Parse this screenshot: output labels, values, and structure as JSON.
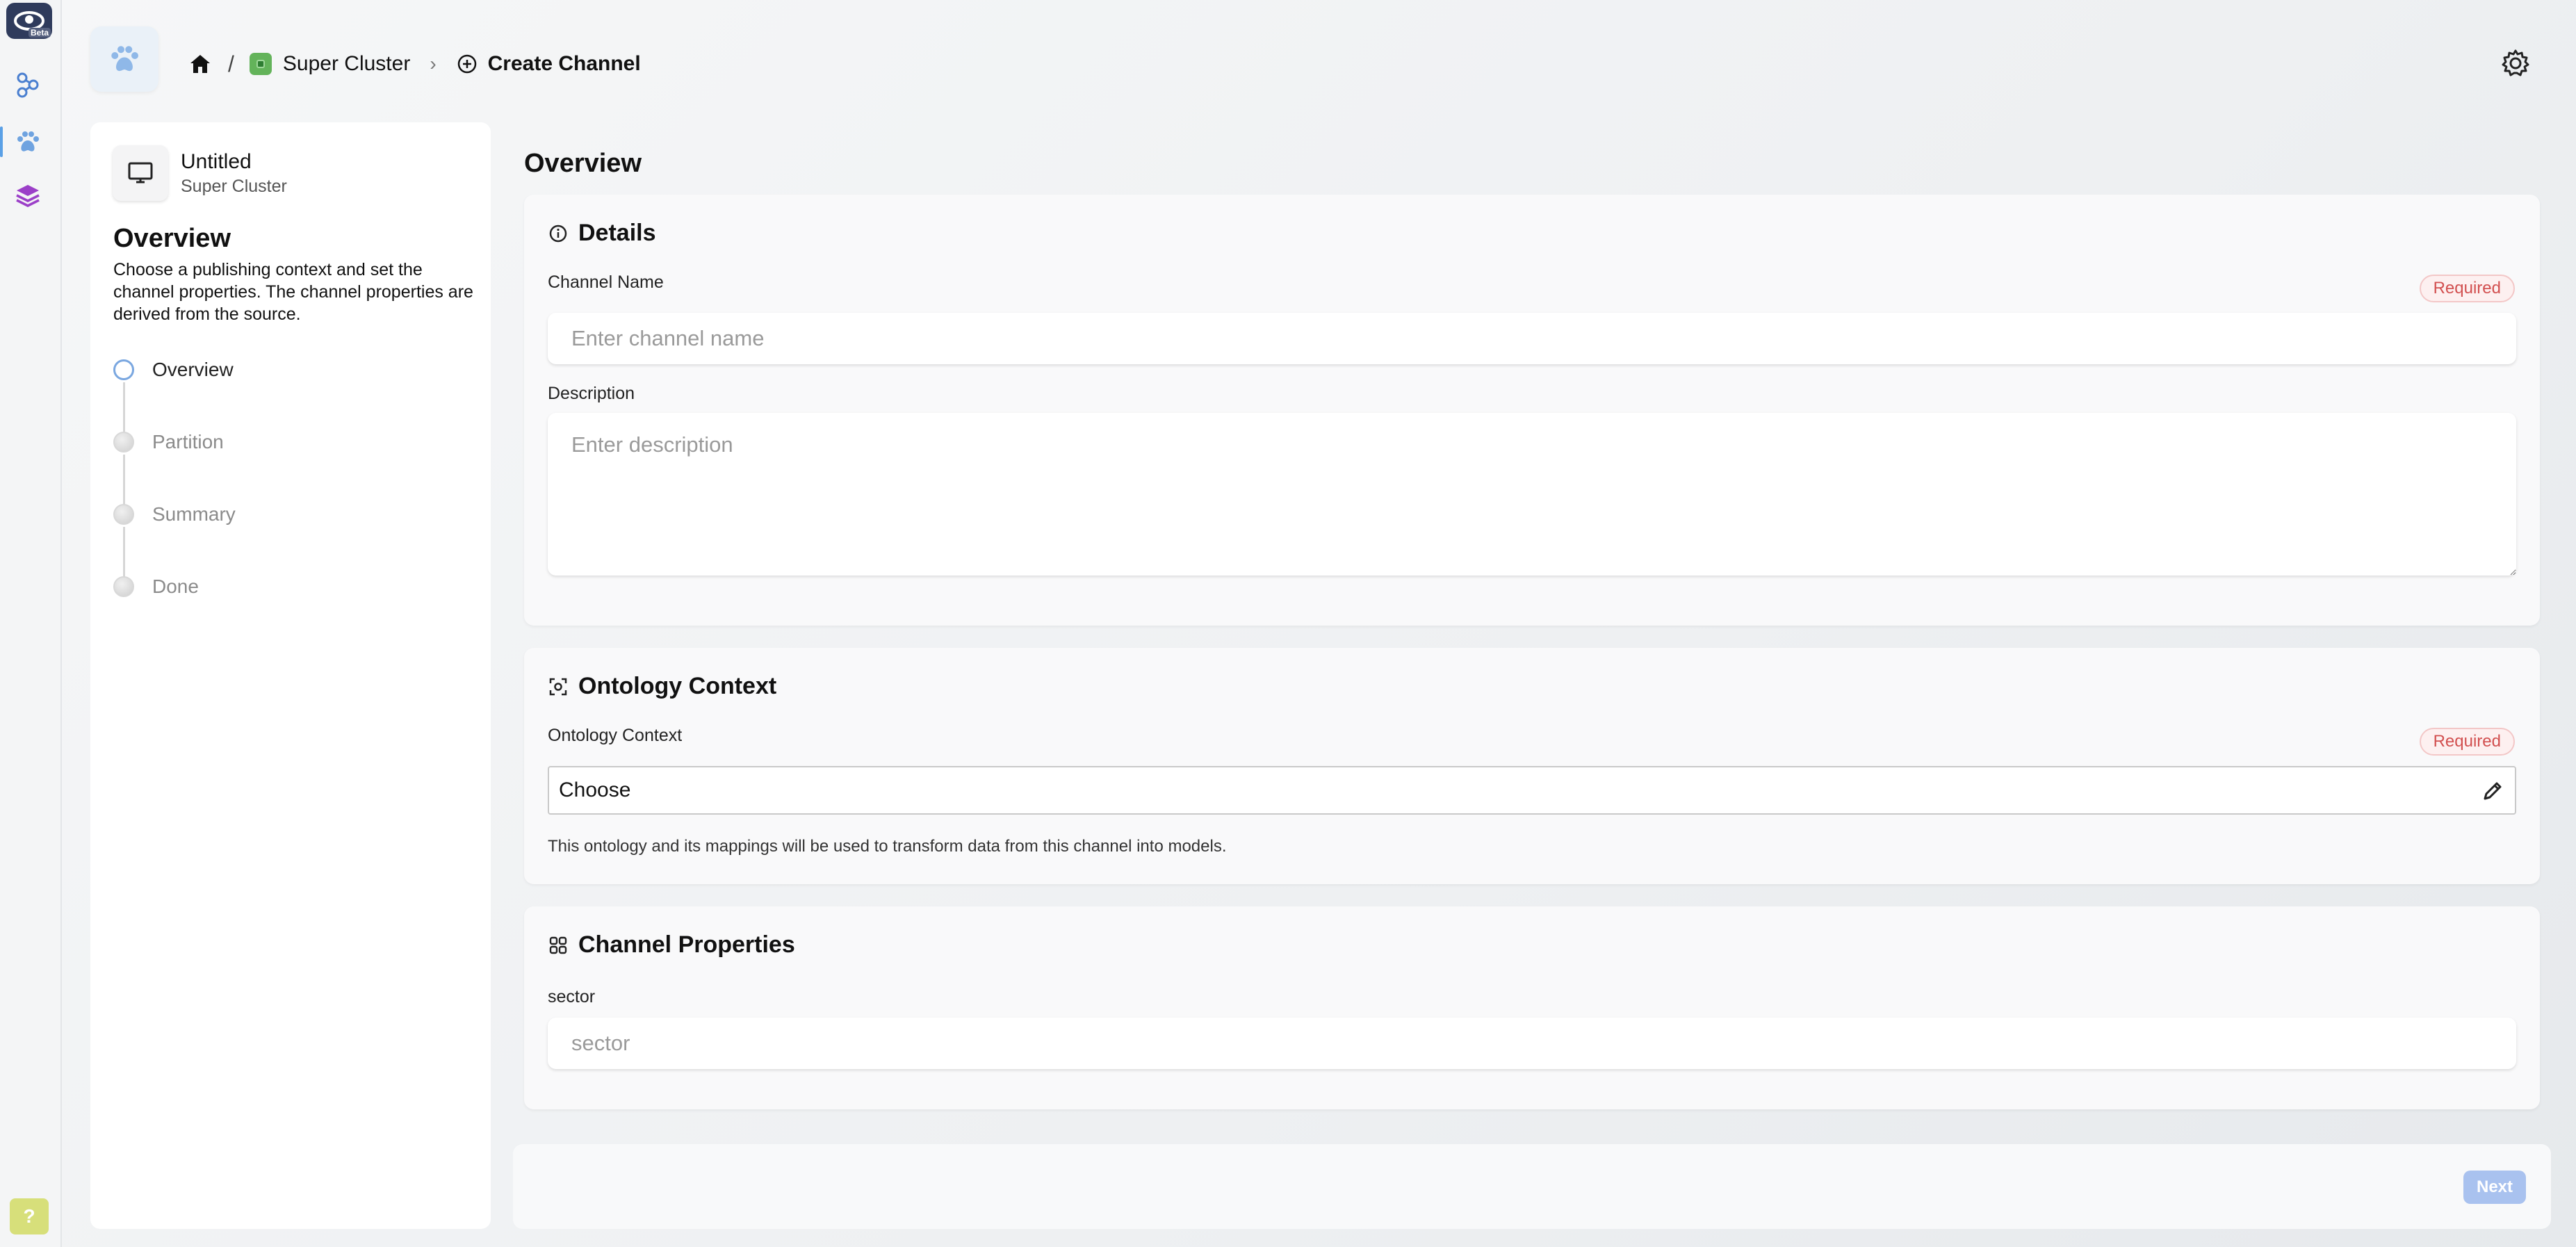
{
  "rail": {
    "logo_badge": "Beta",
    "items": [
      {
        "icon": "graph-nodes-icon"
      },
      {
        "icon": "paw-icon",
        "active": true
      },
      {
        "icon": "layers-icon"
      }
    ],
    "help_label": "?"
  },
  "header": {
    "app_icon": "paw-icon",
    "breadcrumb": {
      "home_icon": "home-icon",
      "cluster": "Super Cluster",
      "current": "Create Channel"
    },
    "settings_icon": "gear-icon"
  },
  "side": {
    "context_title": "Untitled",
    "context_subtitle": "Super Cluster",
    "heading": "Overview",
    "description": "Choose a publishing context and set the channel properties. The channel properties are derived from the source.",
    "steps": [
      {
        "label": "Overview",
        "active": true
      },
      {
        "label": "Partition",
        "active": false
      },
      {
        "label": "Summary",
        "active": false
      },
      {
        "label": "Done",
        "active": false
      }
    ]
  },
  "main": {
    "title": "Overview",
    "details": {
      "heading": "Details",
      "channel_name_label": "Channel Name",
      "required_label": "Required",
      "channel_name_placeholder": "Enter channel name",
      "description_label": "Description",
      "description_placeholder": "Enter description"
    },
    "ontology": {
      "heading": "Ontology Context",
      "field_label": "Ontology Context",
      "required_label": "Required",
      "selected": "Choose",
      "help": "This ontology and its mappings will be used to transform data from this channel into models."
    },
    "properties": {
      "heading": "Channel Properties",
      "sector_label": "sector",
      "sector_placeholder": "sector"
    }
  },
  "footer": {
    "next_label": "Next"
  },
  "colors": {
    "accent": "#5aa0e6",
    "required_text": "#d25050",
    "next_button": "#a9c2ef",
    "cluster_chip": "#63b35a"
  }
}
